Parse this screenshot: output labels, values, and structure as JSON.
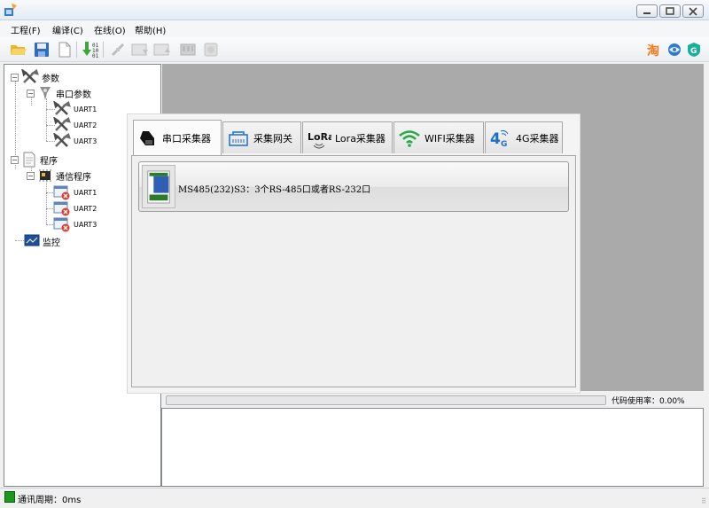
{
  "menu": {
    "items": [
      {
        "label": "工程(F)"
      },
      {
        "label": "编译(C)"
      },
      {
        "label": "在线(O)"
      },
      {
        "label": "帮助(H)"
      }
    ]
  },
  "tree": {
    "params": "参数",
    "serial_params": "串口参数",
    "uart1": "UART1",
    "uart2": "UART2",
    "uart3": "UART3",
    "program": "程序",
    "comm_program": "通信程序",
    "prog_uart1": "UART1",
    "prog_uart2": "UART2",
    "prog_uart3": "UART3",
    "monitor": "监控"
  },
  "dialog": {
    "tabs": [
      {
        "label": "串口采集器"
      },
      {
        "label": "采集网关"
      },
      {
        "label": "Lora采集器"
      },
      {
        "label": "WIFI采集器"
      },
      {
        "label": "4G采集器"
      }
    ],
    "device": "MS485(232)S3：3个RS-485口或者RS-232口"
  },
  "progress": {
    "usage_label": "代码使用率：0.00%",
    "value": 0
  },
  "status": {
    "text": "通讯周期：0ms"
  },
  "colors": {
    "workspace_bg": "#aaaaaa",
    "status_led": "#1a9a1a",
    "accent_blue": "#1e6fc8"
  }
}
